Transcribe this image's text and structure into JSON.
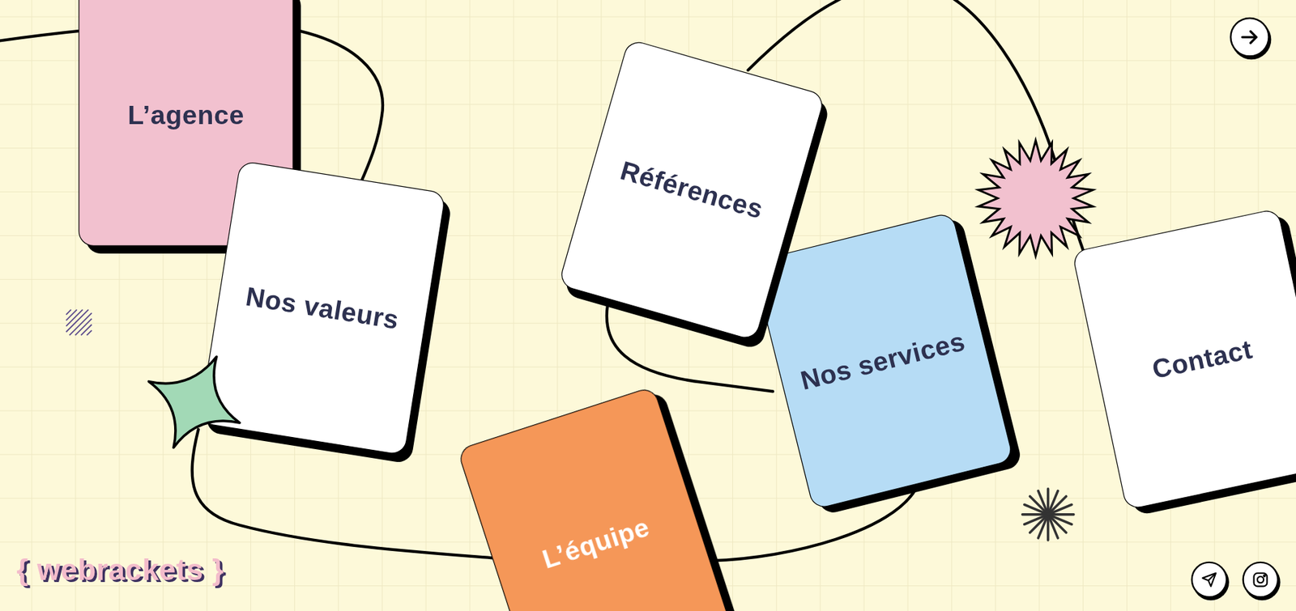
{
  "brand": {
    "logo": "{ webrackets }"
  },
  "cards": [
    {
      "label": "L’agence",
      "color": "#f2c1cf",
      "kind": "dark-text"
    },
    {
      "label": "Nos valeurs",
      "color": "#ffffff",
      "kind": "dark-text"
    },
    {
      "label": "L’équipe",
      "color": "#f59758",
      "kind": "light-text"
    },
    {
      "label": "Nos services",
      "color": "#b6dcf5",
      "kind": "dark-text"
    },
    {
      "label": "Références",
      "color": "#ffffff",
      "kind": "dark-text"
    },
    {
      "label": "Contact",
      "color": "#ffffff",
      "kind": "dark-text"
    }
  ]
}
